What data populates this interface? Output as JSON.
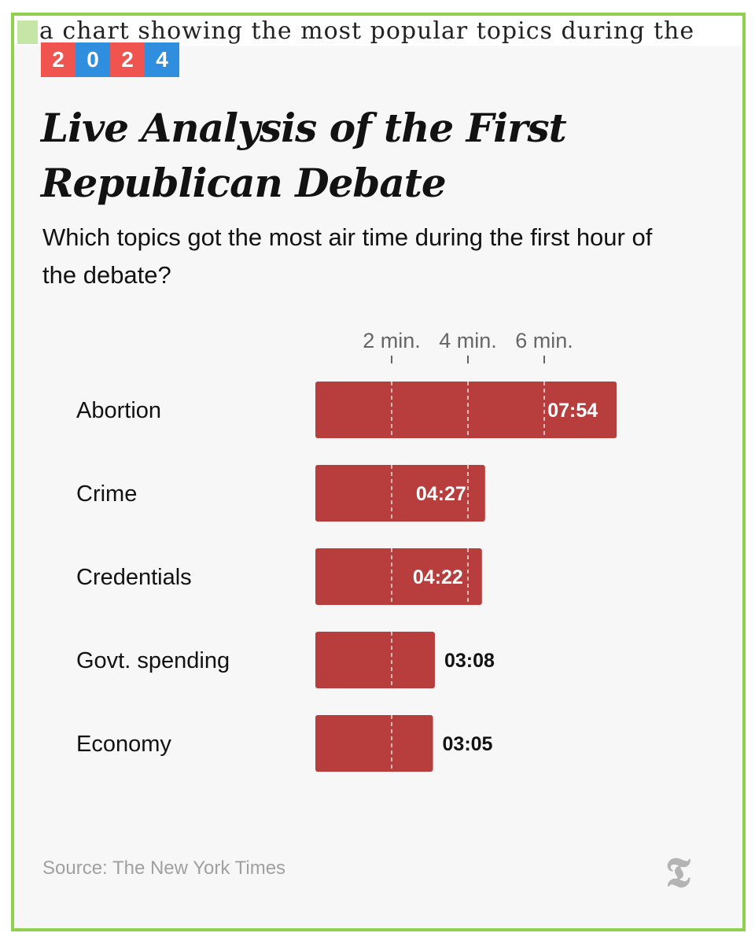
{
  "caption": "a chart showing the most popular topics during the",
  "year_badge": {
    "digits": [
      "2",
      "0",
      "2",
      "4"
    ],
    "colors": [
      "#f0544f",
      "#2f8fde",
      "#f0544f",
      "#2f8fde"
    ]
  },
  "title": "Live Analysis of the First Republican Debate",
  "subtitle": "Which topics got the most air time during the first hour of the debate?",
  "source": "Source: The New York Times",
  "logo_glyph": "T",
  "colors": {
    "bar": "#b83d3d",
    "frame": "#8fd14f"
  },
  "chart_data": {
    "type": "bar",
    "orientation": "horizontal",
    "categories": [
      "Abortion",
      "Crime",
      "Credentials",
      "Govt. spending",
      "Economy"
    ],
    "values": [
      7.9,
      4.45,
      4.367,
      3.133,
      3.083
    ],
    "value_labels": [
      "07:54",
      "04:27",
      "04:22",
      "03:08",
      "03:05"
    ],
    "unit": "minutes",
    "x_ticks": [
      2,
      4,
      6
    ],
    "x_tick_labels": [
      "2 min.",
      "4 min.",
      "6 min."
    ],
    "xlim": [
      0,
      8
    ],
    "grid": true,
    "gridline_style": "dashed"
  }
}
